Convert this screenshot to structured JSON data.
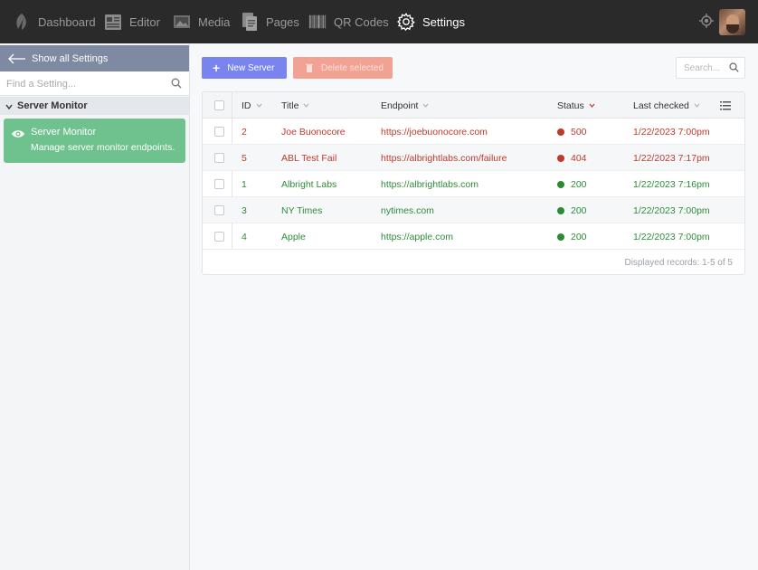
{
  "nav": {
    "items": [
      {
        "label": "Dashboard",
        "icon": "leaf-icon"
      },
      {
        "label": "Editor",
        "icon": "editor-icon"
      },
      {
        "label": "Media",
        "icon": "image-icon"
      },
      {
        "label": "Pages",
        "icon": "pages-icon"
      },
      {
        "label": "QR Codes",
        "icon": "barcode-icon"
      },
      {
        "label": "Settings",
        "icon": "gear-icon",
        "active": true
      }
    ]
  },
  "sidebar": {
    "back_label": "Show all Settings",
    "find_placeholder": "Find a Setting...",
    "group_label": "Server Monitor",
    "active_item": {
      "title": "Server Monitor",
      "description": "Manage server monitor endpoints."
    }
  },
  "toolbar": {
    "new_label": "New Server",
    "delete_label": "Delete selected",
    "search_placeholder": "Search..."
  },
  "table": {
    "columns": [
      "ID",
      "Title",
      "Endpoint",
      "Status",
      "Last checked"
    ],
    "rows": [
      {
        "id": "2",
        "title": "Joe Buonocore",
        "endpoint": "https://joebuonocore.com",
        "status": "500",
        "checked": "1/22/2023 7:00pm",
        "ok": false
      },
      {
        "id": "5",
        "title": "ABL Test Fail",
        "endpoint": "https://albrightlabs.com/failure",
        "status": "404",
        "checked": "1/22/2023 7:17pm",
        "ok": false
      },
      {
        "id": "1",
        "title": "Albright Labs",
        "endpoint": "https://albrightlabs.com",
        "status": "200",
        "checked": "1/22/2023 7:16pm",
        "ok": true
      },
      {
        "id": "3",
        "title": "NY Times",
        "endpoint": "nytimes.com",
        "status": "200",
        "checked": "1/22/2023 7:00pm",
        "ok": true
      },
      {
        "id": "4",
        "title": "Apple",
        "endpoint": "https://apple.com",
        "status": "200",
        "checked": "1/22/2023 7:00pm",
        "ok": true
      }
    ],
    "footer": "Displayed records: 1-5 of 5"
  },
  "colors": {
    "error_text": "#c0392b",
    "ok_text": "#2e8b3a",
    "error_dot": "#c0392b",
    "ok_dot": "#2b8a33",
    "accent": "#7a84ee"
  }
}
